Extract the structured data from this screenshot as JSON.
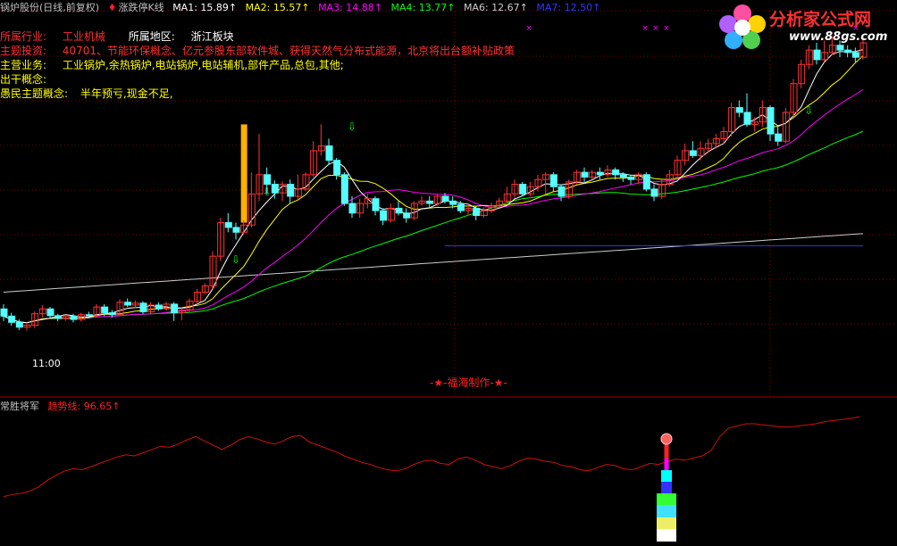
{
  "header": {
    "title": "锅炉股份(日线,前复权)",
    "limit_icon": "♦",
    "limit_label": "涨跌停K线",
    "ma": [
      {
        "label": "MA1: 15.89↑",
        "color": "#ffffff"
      },
      {
        "label": "MA2: 15.57↑",
        "color": "#ffff00"
      },
      {
        "label": "MA3: 14.88↑",
        "color": "#ff00ff"
      },
      {
        "label": "MA4: 13.77↑",
        "color": "#00ff00"
      },
      {
        "label": "MA6: 12.67↑",
        "color": "#cccccc"
      },
      {
        "label": "MA7: 12.50↑",
        "color": "#3333ff"
      }
    ]
  },
  "info": {
    "industry_label": "所属行业:",
    "industry_value": "工业机械",
    "region_label": "所属地区:",
    "region_value": "浙江板块",
    "theme_label": "主题投资:",
    "theme_value": "40701、节能环保概念、亿元参股东部软件城、获得天然气分布式能源，北京将出台额补贴政策",
    "business_label": "主营业务:",
    "business_value": "工业锅炉,余热锅炉,电站锅炉,电站辅机,部件产品,总包,其他;",
    "concept_label": "出干概念:",
    "comment_label": "愚民主题概念:",
    "comment_value": "半年预亏,现金不足,"
  },
  "chart_labels": {
    "time_label": "11:00",
    "maker": "-★-福海制作-★-"
  },
  "indicator": {
    "name": "常胜将军",
    "line_label": "趋势线: 96.65↑"
  },
  "logo": {
    "main": "分析家公式网",
    "url": "www.88gs.com"
  },
  "colors": {
    "up": "#ff3232",
    "down": "#54ffff",
    "grid": "#800000",
    "trend": "#cc1010"
  },
  "chart_data": {
    "type": "candlestick",
    "ylim": [
      10.2,
      16.9
    ],
    "ma_labels": [
      "MA1",
      "MA2",
      "MA3",
      "MA4",
      "MA6",
      "MA7"
    ],
    "ma_last": [
      15.89,
      15.57,
      14.88,
      13.77,
      12.67,
      12.5
    ],
    "candles": [
      [
        11.2,
        11.05,
        11.3,
        10.95
      ],
      [
        11.05,
        10.92,
        11.12,
        10.85
      ],
      [
        10.92,
        10.82,
        10.98,
        10.76
      ],
      [
        10.82,
        10.86,
        10.92,
        10.75
      ],
      [
        10.86,
        11.1,
        11.15,
        10.8
      ],
      [
        11.1,
        11.2,
        11.28,
        11.02
      ],
      [
        11.2,
        11.06,
        11.24,
        11.0
      ],
      [
        11.06,
        11.0,
        11.1,
        10.94
      ],
      [
        11.0,
        11.05,
        11.08,
        10.95
      ],
      [
        11.05,
        10.98,
        11.1,
        10.92
      ],
      [
        10.98,
        11.08,
        11.12,
        10.94
      ],
      [
        11.08,
        11.06,
        11.14,
        11.0
      ],
      [
        11.06,
        11.24,
        11.3,
        11.03
      ],
      [
        11.24,
        11.12,
        11.3,
        11.05
      ],
      [
        11.12,
        11.08,
        11.18,
        11.02
      ],
      [
        11.08,
        11.34,
        11.4,
        11.06
      ],
      [
        11.34,
        11.28,
        11.42,
        11.24
      ],
      [
        11.28,
        11.32,
        11.38,
        11.22
      ],
      [
        11.32,
        11.14,
        11.36,
        11.1
      ],
      [
        11.14,
        11.28,
        11.34,
        11.1
      ],
      [
        11.28,
        11.2,
        11.34,
        11.16
      ],
      [
        11.2,
        11.3,
        11.35,
        11.16
      ],
      [
        11.3,
        11.12,
        11.34,
        10.95
      ],
      [
        11.12,
        11.18,
        11.22,
        10.96
      ],
      [
        11.18,
        11.36,
        11.42,
        11.12
      ],
      [
        11.36,
        11.55,
        11.62,
        11.3
      ],
      [
        11.55,
        11.68,
        11.74,
        11.5
      ],
      [
        11.68,
        12.3,
        12.4,
        11.62
      ],
      [
        12.3,
        13.0,
        13.1,
        12.2
      ],
      [
        13.0,
        12.9,
        13.2,
        12.8
      ],
      [
        12.9,
        12.8,
        13.0,
        12.65
      ],
      [
        12.8,
        12.95,
        13.05,
        12.75
      ],
      [
        12.95,
        13.6,
        14.05,
        12.9
      ],
      [
        13.6,
        14.0,
        14.85,
        13.45
      ],
      [
        14.0,
        13.8,
        14.15,
        13.6
      ],
      [
        13.8,
        13.62,
        13.88,
        13.5
      ],
      [
        13.62,
        13.8,
        13.86,
        13.45
      ],
      [
        13.8,
        13.55,
        13.9,
        13.4
      ],
      [
        13.55,
        13.7,
        14.0,
        13.5
      ],
      [
        13.7,
        14.0,
        14.05,
        13.65
      ],
      [
        14.0,
        14.5,
        14.7,
        13.95
      ],
      [
        14.5,
        14.6,
        15.05,
        14.4
      ],
      [
        14.6,
        14.3,
        14.75,
        14.2
      ],
      [
        14.3,
        14.0,
        14.35,
        13.9
      ],
      [
        14.0,
        13.4,
        14.05,
        13.35
      ],
      [
        13.4,
        13.2,
        13.55,
        13.1
      ],
      [
        13.2,
        13.4,
        13.5,
        13.1
      ],
      [
        13.4,
        13.5,
        13.6,
        13.3
      ],
      [
        13.5,
        13.25,
        13.55,
        13.15
      ],
      [
        13.25,
        13.05,
        13.3,
        12.95
      ],
      [
        13.05,
        13.3,
        13.4,
        13.0
      ],
      [
        13.3,
        13.2,
        13.45,
        13.15
      ],
      [
        13.2,
        13.1,
        13.3,
        13.0
      ],
      [
        13.1,
        13.4,
        13.45,
        13.05
      ],
      [
        13.4,
        13.45,
        13.55,
        13.35
      ],
      [
        13.45,
        13.4,
        13.55,
        13.3
      ],
      [
        13.4,
        13.55,
        13.6,
        13.35
      ],
      [
        13.55,
        13.45,
        13.62,
        13.4
      ],
      [
        13.45,
        13.38,
        13.55,
        13.3
      ],
      [
        13.38,
        13.25,
        13.45,
        13.2
      ],
      [
        13.25,
        13.3,
        13.4,
        13.15
      ],
      [
        13.3,
        13.15,
        13.35,
        13.05
      ],
      [
        13.15,
        13.25,
        13.32,
        13.1
      ],
      [
        13.25,
        13.35,
        13.42,
        13.2
      ],
      [
        13.35,
        13.45,
        13.52,
        13.3
      ],
      [
        13.45,
        13.6,
        13.75,
        13.4
      ],
      [
        13.6,
        13.8,
        13.9,
        13.5
      ],
      [
        13.8,
        13.6,
        13.85,
        13.55
      ],
      [
        13.6,
        13.75,
        13.85,
        13.55
      ],
      [
        13.75,
        13.9,
        14.0,
        13.65
      ],
      [
        13.9,
        14.0,
        14.05,
        13.6
      ],
      [
        14.0,
        13.75,
        14.05,
        13.65
      ],
      [
        13.75,
        13.55,
        13.8,
        13.45
      ],
      [
        13.55,
        13.85,
        13.9,
        13.5
      ],
      [
        13.85,
        14.05,
        14.1,
        13.8
      ],
      [
        14.05,
        13.95,
        14.15,
        13.85
      ],
      [
        13.95,
        14.05,
        14.1,
        13.9
      ],
      [
        14.05,
        14.0,
        14.15,
        13.9
      ],
      [
        14.0,
        14.1,
        14.2,
        13.95
      ],
      [
        14.1,
        14.0,
        14.15,
        13.9
      ],
      [
        14.0,
        13.95,
        14.05,
        13.85
      ],
      [
        13.95,
        13.9,
        14.0,
        13.8
      ],
      [
        13.9,
        14.0,
        14.05,
        13.8
      ],
      [
        14.0,
        13.7,
        14.05,
        13.65
      ],
      [
        13.7,
        13.55,
        13.8,
        13.45
      ],
      [
        13.55,
        13.8,
        13.9,
        13.5
      ],
      [
        13.8,
        14.0,
        14.1,
        13.75
      ],
      [
        14.0,
        14.3,
        14.4,
        13.9
      ],
      [
        14.3,
        14.5,
        14.65,
        14.2
      ],
      [
        14.5,
        14.4,
        14.7,
        14.35
      ],
      [
        14.4,
        14.55,
        14.7,
        14.3
      ],
      [
        14.55,
        14.65,
        14.75,
        14.45
      ],
      [
        14.65,
        14.75,
        14.85,
        14.55
      ],
      [
        14.75,
        14.9,
        15.0,
        14.65
      ],
      [
        14.9,
        15.4,
        15.5,
        14.8
      ],
      [
        15.4,
        15.3,
        15.55,
        15.2
      ],
      [
        15.3,
        15.05,
        15.7,
        15.0
      ],
      [
        15.05,
        15.1,
        15.2,
        14.9
      ],
      [
        15.1,
        15.4,
        15.55,
        15.0
      ],
      [
        15.4,
        14.85,
        15.45,
        14.7
      ],
      [
        14.85,
        14.7,
        15.0,
        14.6
      ],
      [
        14.7,
        15.3,
        15.4,
        14.65
      ],
      [
        15.3,
        15.9,
        16.0,
        15.2
      ],
      [
        15.9,
        16.3,
        16.4,
        15.8
      ],
      [
        16.3,
        16.6,
        16.7,
        16.2
      ],
      [
        16.6,
        16.4,
        16.75,
        16.3
      ],
      [
        16.4,
        16.55,
        16.8,
        16.35
      ],
      [
        16.55,
        16.7,
        16.9,
        16.5
      ],
      [
        16.7,
        16.6,
        16.8,
        16.45
      ],
      [
        16.6,
        16.55,
        16.7,
        16.45
      ],
      [
        16.55,
        16.45,
        16.65,
        16.35
      ],
      [
        16.45,
        16.75,
        16.85,
        16.4
      ]
    ],
    "trend_line": [
      22,
      24,
      25,
      27,
      31,
      37,
      42,
      46,
      48,
      47,
      50,
      53,
      56,
      59,
      61,
      60,
      63,
      66,
      69,
      68,
      71,
      75,
      78,
      74,
      70,
      66,
      70,
      75,
      78,
      76,
      73,
      71,
      74,
      78,
      79,
      73,
      70,
      67,
      64,
      60,
      57,
      54,
      52,
      49,
      47,
      46,
      48,
      52,
      55,
      56,
      53,
      52,
      57,
      59,
      56,
      52,
      50,
      48,
      51,
      55,
      58,
      57,
      55,
      54,
      51,
      50,
      47,
      46,
      49,
      52,
      51,
      48,
      47,
      50,
      53,
      52,
      55,
      57,
      56,
      58,
      60,
      65,
      78,
      86,
      88,
      90,
      90,
      89,
      88,
      87,
      87,
      88,
      89,
      90,
      92,
      93,
      94,
      95,
      96.65
    ]
  }
}
